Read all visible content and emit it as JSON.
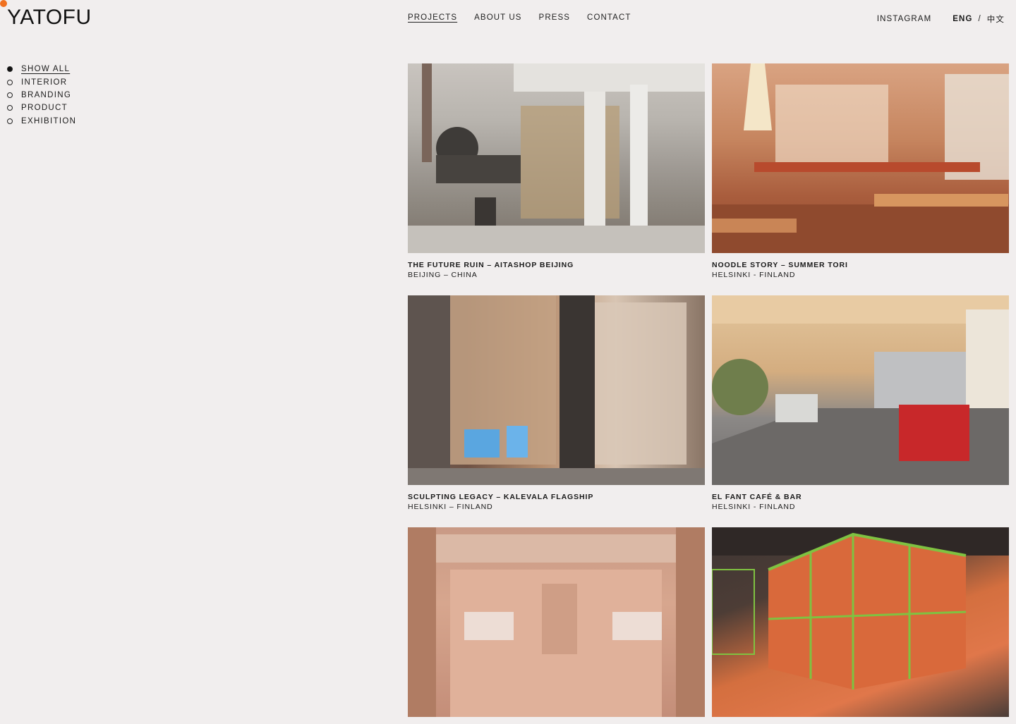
{
  "brand": {
    "logo_text": "YATOFU",
    "accent_color": "#f0701f"
  },
  "nav": {
    "items": [
      {
        "label": "PROJECTS",
        "active": true
      },
      {
        "label": "ABOUT US",
        "active": false
      },
      {
        "label": "PRESS",
        "active": false
      },
      {
        "label": "CONTACT",
        "active": false
      }
    ]
  },
  "right_nav": {
    "instagram": "INSTAGRAM",
    "lang_en": "ENG",
    "separator": "/",
    "lang_zh": "中文"
  },
  "filters": [
    {
      "label": "SHOW ALL",
      "selected": true
    },
    {
      "label": "INTERIOR",
      "selected": false
    },
    {
      "label": "BRANDING",
      "selected": false
    },
    {
      "label": "PRODUCT",
      "selected": false
    },
    {
      "label": "EXHIBITION",
      "selected": false
    }
  ],
  "projects": [
    {
      "title": "THE FUTURE RUIN – AITASHOP BEIJING",
      "location": "BEIJING – CHINA"
    },
    {
      "title": "NOODLE STORY – SUMMER TORI",
      "location": "HELSINKI - FINLAND"
    },
    {
      "title": "SCULPTING LEGACY – KALEVALA FLAGSHIP",
      "location": "HELSINKI – FINLAND"
    },
    {
      "title": "EL FANT CAFÉ & BAR",
      "location": "HELSINKI - FINLAND"
    },
    {
      "title": "",
      "location": ""
    },
    {
      "title": "",
      "location": ""
    }
  ]
}
